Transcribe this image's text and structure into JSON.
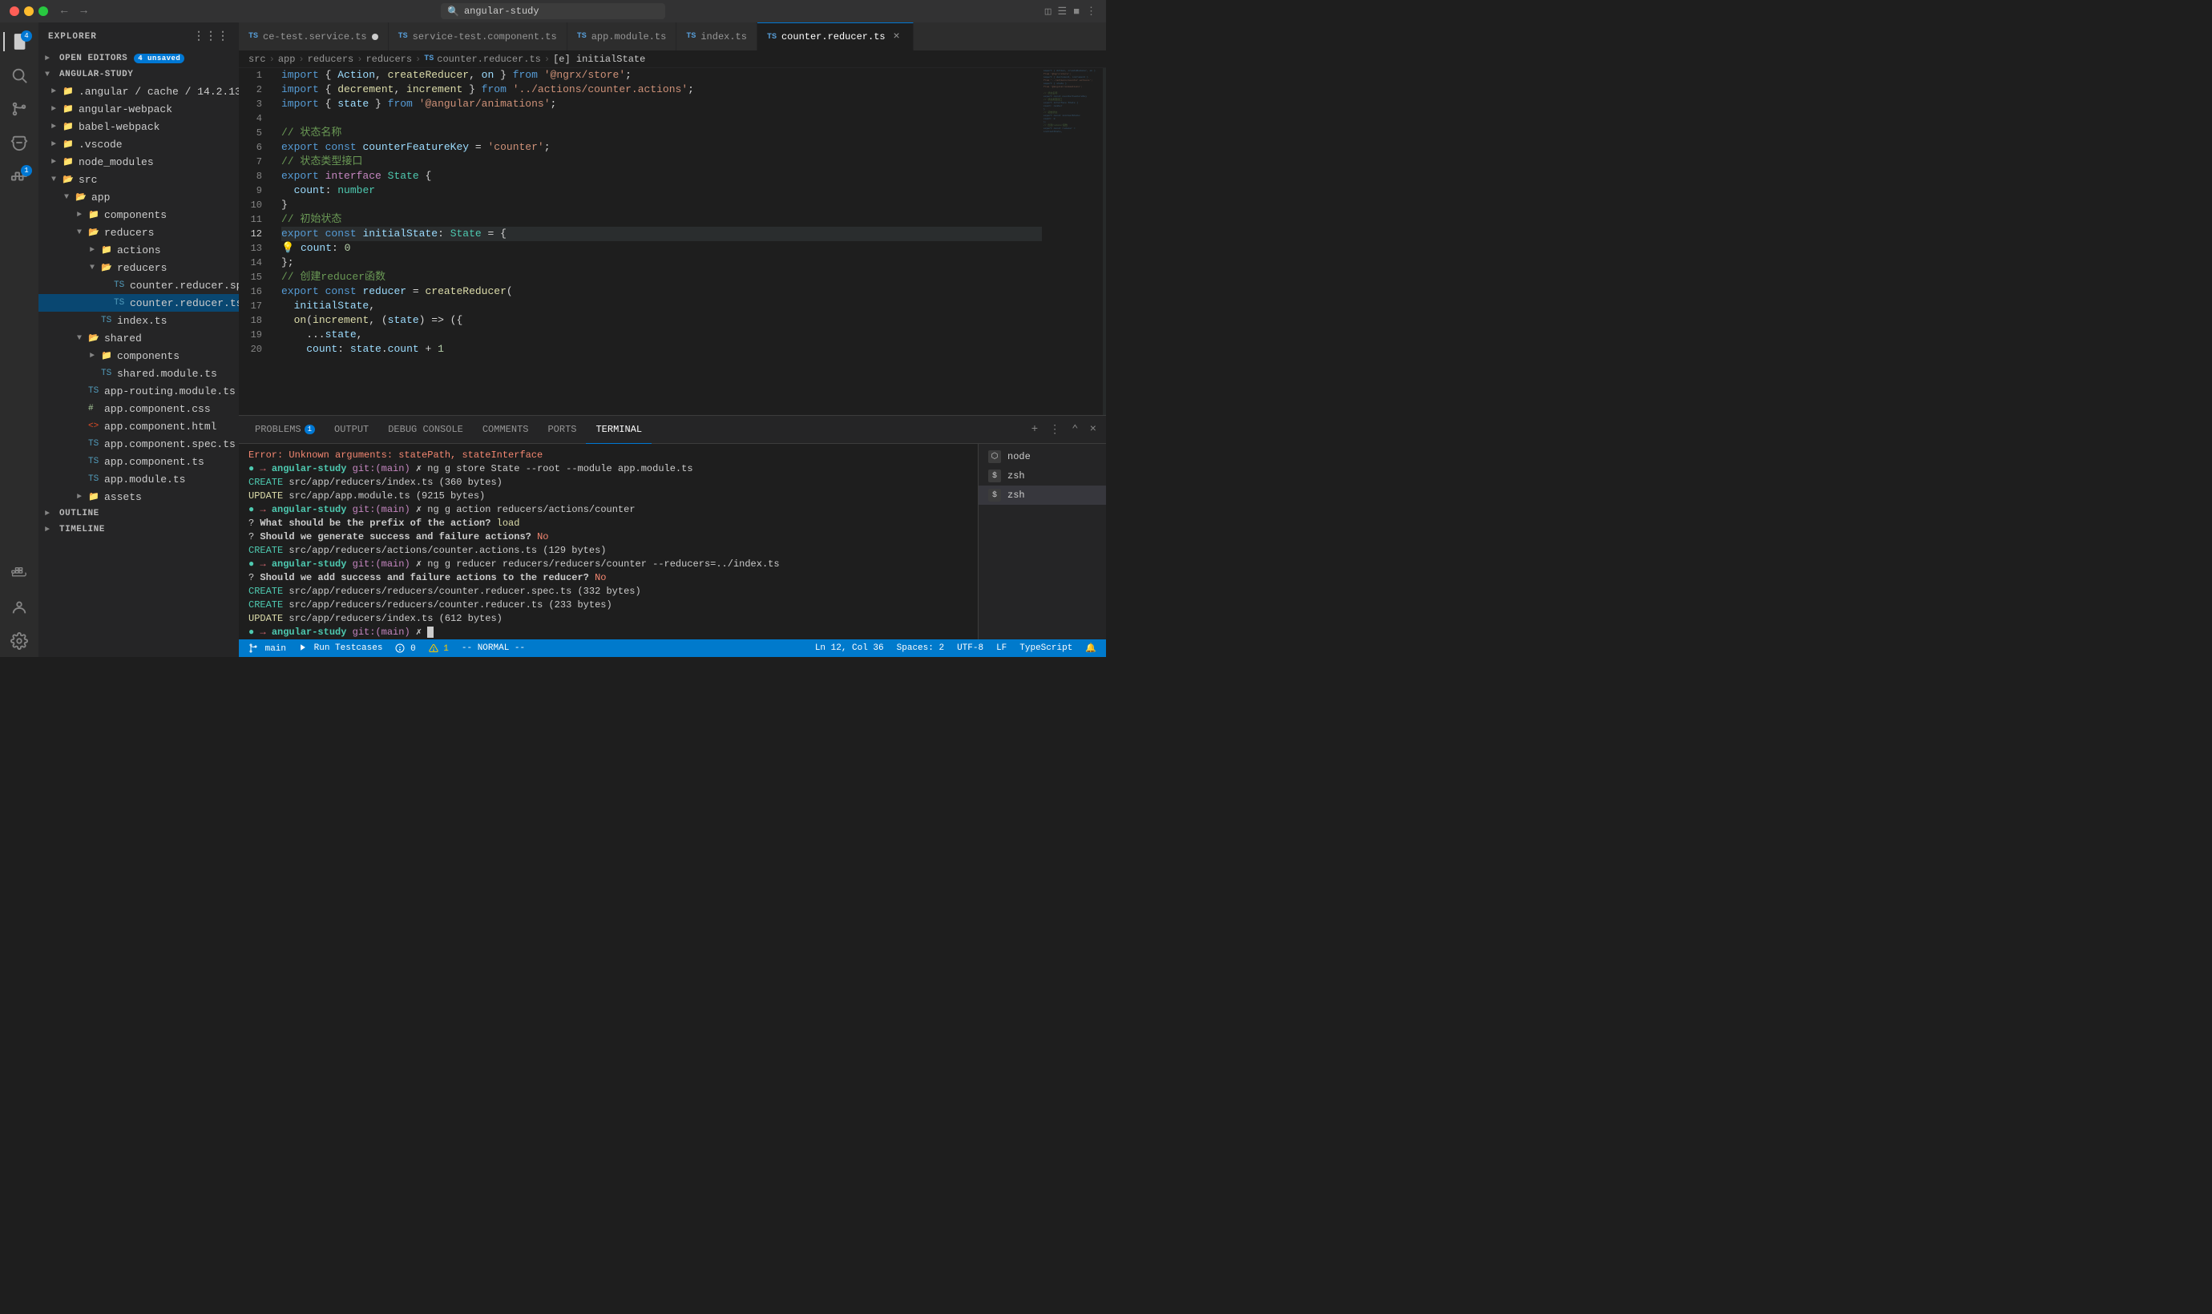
{
  "titlebar": {
    "search_placeholder": "angular-study",
    "nav_back": "←",
    "nav_forward": "→"
  },
  "tabs": [
    {
      "id": "tab1",
      "label": "ce-test.service.ts",
      "type": "ts",
      "modified": true,
      "active": false
    },
    {
      "id": "tab2",
      "label": "service-test.component.ts",
      "type": "ts",
      "modified": false,
      "active": false
    },
    {
      "id": "tab3",
      "label": "app.module.ts",
      "type": "ts",
      "modified": false,
      "active": false
    },
    {
      "id": "tab4",
      "label": "index.ts",
      "type": "ts",
      "modified": false,
      "active": false
    },
    {
      "id": "tab5",
      "label": "counter.reducer.ts",
      "type": "ts",
      "modified": false,
      "active": true
    }
  ],
  "breadcrumb": {
    "items": [
      "src",
      "app",
      "reducers",
      "reducers",
      "counter.reducer.ts",
      "initialState"
    ]
  },
  "sidebar": {
    "title": "EXPLORER",
    "open_editors_label": "OPEN EDITORS",
    "open_editors_badge": "4 unsaved",
    "project_name": "ANGULAR-STUDY",
    "items": [
      {
        "label": ".angular / cache / 14.2.13",
        "indent": 1,
        "type": "folder",
        "open": false
      },
      {
        "label": "angular-webpack",
        "indent": 1,
        "type": "folder",
        "open": false
      },
      {
        "label": "babel-webpack",
        "indent": 1,
        "type": "folder",
        "open": false
      },
      {
        "label": ".vscode",
        "indent": 1,
        "type": "folder",
        "open": false
      },
      {
        "label": "node_modules",
        "indent": 1,
        "type": "folder",
        "open": false
      },
      {
        "label": "src",
        "indent": 1,
        "type": "folder",
        "open": true
      },
      {
        "label": "app",
        "indent": 2,
        "type": "folder",
        "open": true
      },
      {
        "label": "components",
        "indent": 3,
        "type": "folder",
        "open": false
      },
      {
        "label": "reducers",
        "indent": 3,
        "type": "folder",
        "open": true
      },
      {
        "label": "actions",
        "indent": 4,
        "type": "folder",
        "open": false
      },
      {
        "label": "reducers",
        "indent": 4,
        "type": "folder",
        "open": true
      },
      {
        "label": "counter.reducer.spec.ts",
        "indent": 5,
        "type": "ts"
      },
      {
        "label": "counter.reducer.ts",
        "indent": 5,
        "type": "ts",
        "selected": true
      },
      {
        "label": "index.ts",
        "indent": 4,
        "type": "ts"
      },
      {
        "label": "shared",
        "indent": 3,
        "type": "folder",
        "open": true
      },
      {
        "label": "components",
        "indent": 4,
        "type": "folder",
        "open": false
      },
      {
        "label": "shared.module.ts",
        "indent": 4,
        "type": "ts"
      },
      {
        "label": "app-routing.module.ts",
        "indent": 3,
        "type": "ts"
      },
      {
        "label": "app.component.css",
        "indent": 3,
        "type": "css"
      },
      {
        "label": "app.component.html",
        "indent": 3,
        "type": "html"
      },
      {
        "label": "app.component.spec.ts",
        "indent": 3,
        "type": "ts"
      },
      {
        "label": "app.component.ts",
        "indent": 3,
        "type": "ts"
      },
      {
        "label": "app.module.ts",
        "indent": 3,
        "type": "ts"
      },
      {
        "label": "assets",
        "indent": 3,
        "type": "folder",
        "open": false
      }
    ],
    "outline_label": "OUTLINE",
    "timeline_label": "TIMELINE"
  },
  "code_lines": [
    {
      "num": 1,
      "content": "import { Action, createReducer, on } from '@ngrx/store';"
    },
    {
      "num": 2,
      "content": "import { decrement, increment } from '../actions/counter.actions';"
    },
    {
      "num": 3,
      "content": "import { state } from '@angular/animations';"
    },
    {
      "num": 4,
      "content": ""
    },
    {
      "num": 5,
      "content": "// 状态名称"
    },
    {
      "num": 6,
      "content": "export const counterFeatureKey = 'counter';"
    },
    {
      "num": 7,
      "content": "// 状态类型接口"
    },
    {
      "num": 8,
      "content": "export interface State {"
    },
    {
      "num": 9,
      "content": "  count: number"
    },
    {
      "num": 10,
      "content": "}"
    },
    {
      "num": 11,
      "content": "// 初始状态"
    },
    {
      "num": 12,
      "content": "export const initialState: State = {",
      "highlight": true
    },
    {
      "num": 13,
      "content": "  count: 0"
    },
    {
      "num": 14,
      "content": "};"
    },
    {
      "num": 15,
      "content": "// 创建reducer函数"
    },
    {
      "num": 16,
      "content": "export const reducer = createReducer("
    },
    {
      "num": 17,
      "content": "  initialState,"
    },
    {
      "num": 18,
      "content": "  on(increment, (state) => ({"
    },
    {
      "num": 19,
      "content": "    ...state,"
    },
    {
      "num": 20,
      "content": "    count: state.count + 1"
    }
  ],
  "terminal": {
    "tabs": [
      "PROBLEMS",
      "OUTPUT",
      "DEBUG CONSOLE",
      "COMMENTS",
      "PORTS",
      "TERMINAL"
    ],
    "active_tab": "TERMINAL",
    "problems_count": 1,
    "terminal_sessions": [
      "node",
      "zsh",
      "zsh"
    ],
    "active_session": 2
  },
  "status_bar": {
    "git_branch": "main",
    "errors": "0",
    "warnings": "1",
    "vim_mode": "-- NORMAL --",
    "run_label": "Run Testcases",
    "ln": "Ln 12, Col 36",
    "spaces": "Spaces: 2",
    "encoding": "UTF-8",
    "line_ending": "LF",
    "language": "TypeScript"
  }
}
